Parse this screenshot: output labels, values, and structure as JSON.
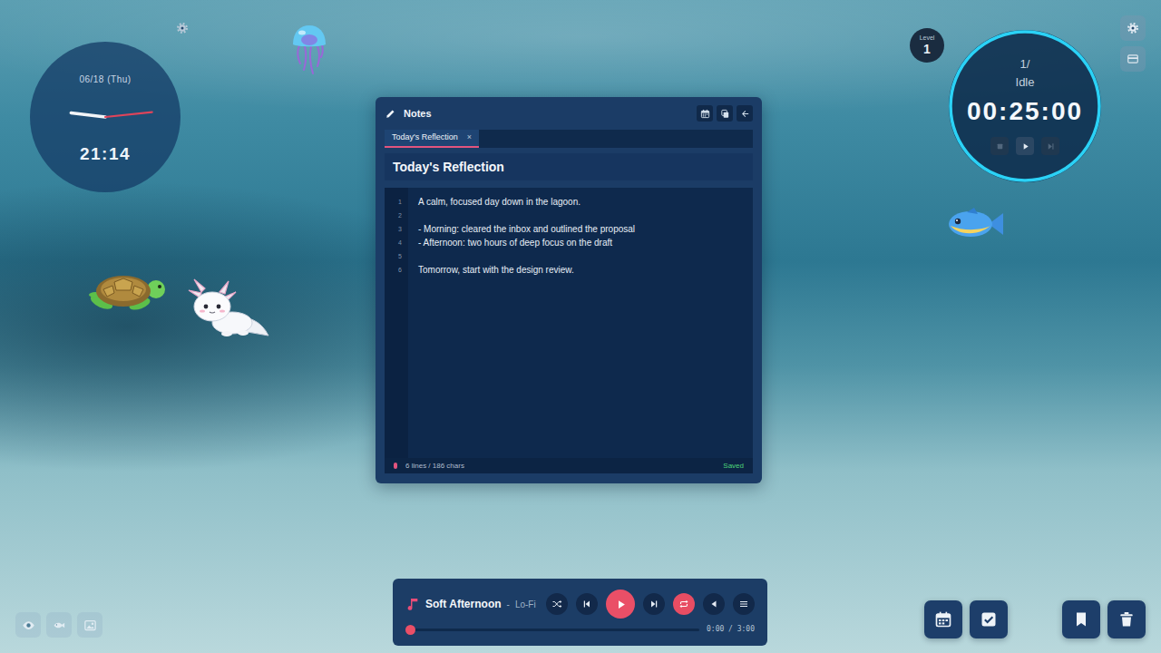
{
  "clock": {
    "date": "06/18 (Thu)",
    "time": "21:14"
  },
  "pets": [
    {
      "kind": "jellyfish"
    },
    {
      "kind": "turtle"
    },
    {
      "kind": "axolotl"
    },
    {
      "kind": "fish"
    }
  ],
  "notes": {
    "title": "Notes",
    "tabs": [
      {
        "label": "Today's Reflection",
        "close": "×",
        "selected": true
      }
    ],
    "document_title": "Today's Reflection",
    "lines": [
      {
        "number": "1",
        "text": "A calm, focused day down in the lagoon."
      },
      {
        "number": "2",
        "text": ""
      },
      {
        "number": "3",
        "text": "- Morning: cleared the inbox and outlined the proposal"
      },
      {
        "number": "4",
        "text": "- Afternoon: two hours of deep focus on the draft"
      },
      {
        "number": "5",
        "text": ""
      },
      {
        "number": "6",
        "text": "Tomorrow, start with the design review."
      }
    ],
    "stats": "6 lines / 186 chars",
    "status": "Saved"
  },
  "level": {
    "label": "Level",
    "value": "1"
  },
  "timer": {
    "round": "1/",
    "state": "Idle",
    "time": "00:25:00",
    "level": 1,
    "controls": [
      {
        "kind": "stop",
        "disabled": true
      },
      {
        "kind": "play",
        "disabled": false
      },
      {
        "kind": "skip",
        "disabled": true
      }
    ]
  },
  "player": {
    "title": "Soft Afternoon",
    "separator": "-",
    "genre": "Lo-Fi",
    "shuffle": false,
    "repeat": true,
    "level": 0,
    "time": "0:00 / 3:00"
  }
}
